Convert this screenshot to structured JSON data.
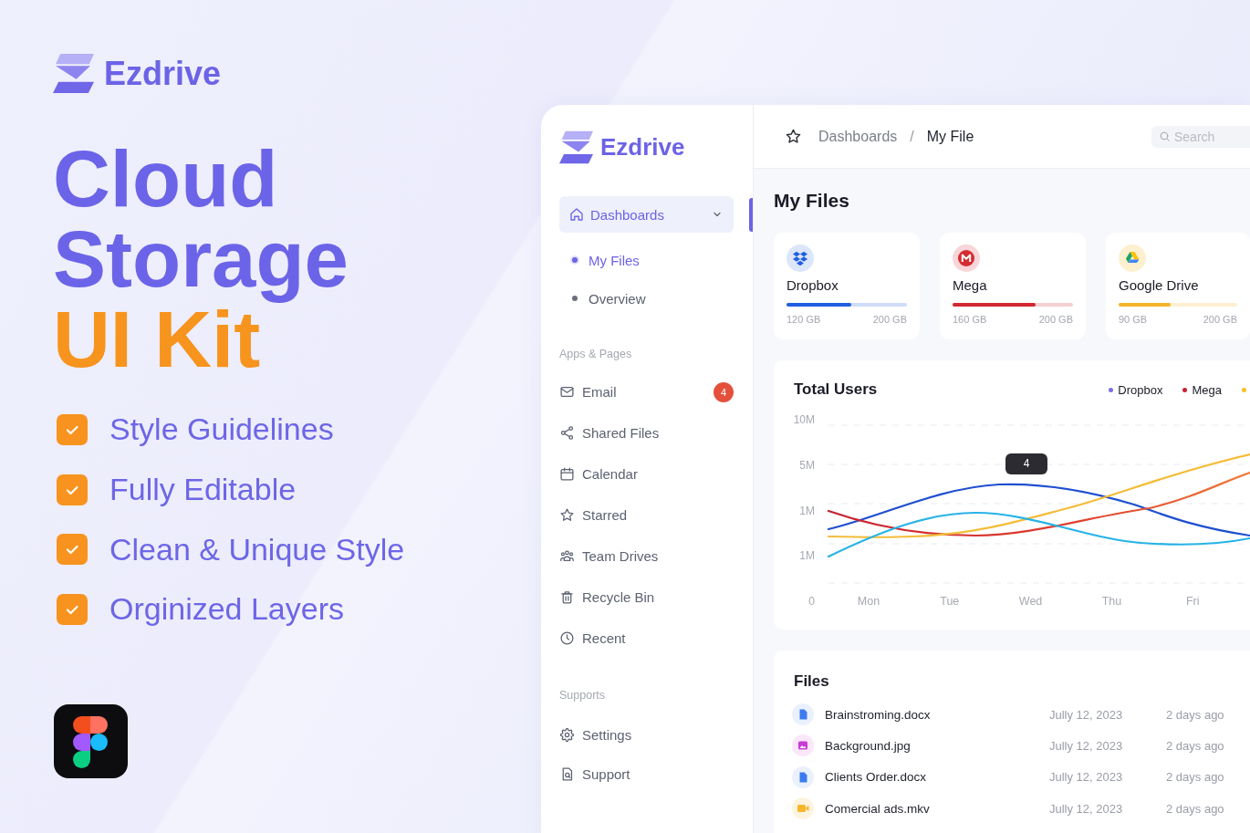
{
  "promo": {
    "brand": "Ezdrive",
    "headline": [
      {
        "text": "Cloud",
        "kind": "primary"
      },
      {
        "text": "Storage",
        "kind": "primary"
      },
      {
        "text": "UI Kit",
        "kind": "accent"
      }
    ],
    "features": [
      {
        "label": "Style Guidelines",
        "checked": true
      },
      {
        "label": "Fully Editable",
        "checked": true
      },
      {
        "label": "Clean & Unique Style",
        "checked": true
      },
      {
        "label": "Orginized Layers",
        "checked": true
      }
    ]
  },
  "sidebar": {
    "brand": "Ezdrive",
    "nav": {
      "label": "Dashboards",
      "selected": true,
      "expanded": true,
      "children": [
        {
          "label": "My Files",
          "selected": true
        },
        {
          "label": "Overview",
          "selected": false
        }
      ]
    },
    "sections": [
      {
        "title": "Apps & Pages",
        "items": [
          {
            "label": "Email",
            "badge": "4",
            "selected": false
          },
          {
            "label": "Shared Files",
            "selected": false
          },
          {
            "label": "Calendar",
            "selected": false
          },
          {
            "label": "Starred",
            "selected": false
          },
          {
            "label": "Team Drives",
            "selected": false
          },
          {
            "label": "Recycle Bin",
            "selected": false
          },
          {
            "label": "Recent",
            "selected": false
          }
        ]
      },
      {
        "title": "Supports",
        "items": [
          {
            "label": "Settings",
            "selected": false
          },
          {
            "label": "Support",
            "selected": false
          }
        ]
      }
    ]
  },
  "topbar": {
    "breadcrumb": [
      {
        "label": "Dashboards",
        "current": false
      },
      {
        "label": "My File",
        "current": true
      }
    ],
    "separator": "/",
    "search": {
      "placeholder": "Search"
    }
  },
  "page_title": "My Files",
  "storage_cards": [
    {
      "name": "Dropbox",
      "used": "120 GB",
      "total": "200 GB",
      "level": 0.54,
      "color": "#1f5ee0"
    },
    {
      "name": "Mega",
      "used": "160 GB",
      "total": "200 GB",
      "level": 0.69,
      "color": "#d22631"
    },
    {
      "name": "Google Drive",
      "used": "90 GB",
      "total": "200 GB",
      "level": 0.44,
      "color": "#f4b429"
    }
  ],
  "chart": {
    "title": "Total Users",
    "legend": [
      {
        "name": "Dropbox",
        "color": "#7b6fe3"
      },
      {
        "name": "Mega",
        "color": "#c8202f"
      },
      {
        "color": "#f5c024"
      }
    ],
    "y_labels": [
      "10M",
      "5M",
      "1M",
      "1M",
      "0"
    ],
    "x_labels": [
      "Mon",
      "Tue",
      "Wed",
      "Thu",
      "Fri"
    ],
    "tooltip": "4"
  },
  "files": {
    "title": "Files",
    "rows": [
      {
        "name": "Brainstroming.docx",
        "kind": "document",
        "date": "Jully 12, 2023",
        "modified": "2 days ago"
      },
      {
        "name": "Background.jpg",
        "kind": "image",
        "date": "Jully 12, 2023",
        "modified": "2 days ago"
      },
      {
        "name": "Clients Order.docx",
        "kind": "document",
        "date": "Jully 12, 2023",
        "modified": "2 days ago"
      },
      {
        "name": "Comercial ads.mkv",
        "kind": "video",
        "date": "Jully 12, 2023",
        "modified": "2 days ago"
      }
    ]
  }
}
